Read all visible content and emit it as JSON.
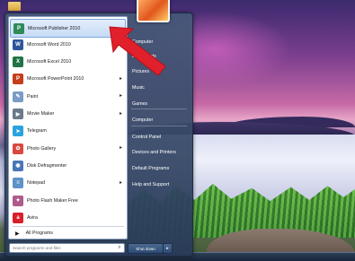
{
  "start_menu": {
    "programs": [
      {
        "label": "Microsoft Publisher 2010",
        "icon": "publisher-icon",
        "color": "#2e8b57",
        "glyph": "P",
        "submenu": false,
        "selected": true
      },
      {
        "label": "Microsoft Word 2010",
        "icon": "word-icon",
        "color": "#2b579a",
        "glyph": "W",
        "submenu": false,
        "selected": false
      },
      {
        "label": "Microsoft Excel 2010",
        "icon": "excel-icon",
        "color": "#217346",
        "glyph": "X",
        "submenu": false,
        "selected": false
      },
      {
        "label": "Microsoft PowerPoint 2010",
        "icon": "powerpoint-icon",
        "color": "#c43e1c",
        "glyph": "P",
        "submenu": true,
        "selected": false
      },
      {
        "label": "Paint",
        "icon": "paint-icon",
        "color": "#7a9cc6",
        "glyph": "✎",
        "submenu": true,
        "selected": false
      },
      {
        "label": "Movie Maker",
        "icon": "movie-maker-icon",
        "color": "#6a7a8a",
        "glyph": "▶",
        "submenu": true,
        "selected": false
      },
      {
        "label": "Telegram",
        "icon": "telegram-icon",
        "color": "#2aa3de",
        "glyph": "➤",
        "submenu": false,
        "selected": false
      },
      {
        "label": "Photo Gallery",
        "icon": "photo-gallery-icon",
        "color": "#d9473f",
        "glyph": "✿",
        "submenu": true,
        "selected": false
      },
      {
        "label": "Disk Defragmenter",
        "icon": "disk-defragmenter-icon",
        "color": "#4a76b8",
        "glyph": "◉",
        "submenu": false,
        "selected": false
      },
      {
        "label": "Notepad",
        "icon": "notepad-icon",
        "color": "#5d92c9",
        "glyph": "≡",
        "submenu": true,
        "selected": false
      },
      {
        "label": "Photo Flash Maker Free",
        "icon": "photo-flash-maker-icon",
        "color": "#b05a8c",
        "glyph": "✦",
        "submenu": false,
        "selected": false
      },
      {
        "label": "Avira",
        "icon": "avira-icon",
        "color": "#d8202a",
        "glyph": "a",
        "submenu": false,
        "selected": false
      }
    ],
    "all_programs": "All Programs",
    "search_placeholder": "Search programs and files",
    "user_tile_icon": "user-picture-icon",
    "right_items": [
      {
        "label": "Computer",
        "key": "computer"
      },
      {
        "label": "Documents",
        "key": "documents"
      },
      {
        "label": "Pictures",
        "key": "pictures"
      },
      {
        "label": "Music",
        "key": "music"
      },
      {
        "label": "Games",
        "key": "games"
      },
      {
        "label": "Computer",
        "key": "computer-2"
      },
      {
        "label": "Control Panel",
        "key": "control-panel"
      },
      {
        "label": "Devices and Printers",
        "key": "devices-and-printers"
      },
      {
        "label": "Default Programs",
        "key": "default-programs"
      },
      {
        "label": "Help and Support",
        "key": "help-and-support"
      }
    ],
    "shutdown_label": "Shut down"
  },
  "annotation": {
    "arrow_color": "#e0202a",
    "arrow_icon": "red-pointer-arrow"
  },
  "colors": {
    "selection": "#c6dbf5",
    "menu_bg": "#3a5275"
  }
}
